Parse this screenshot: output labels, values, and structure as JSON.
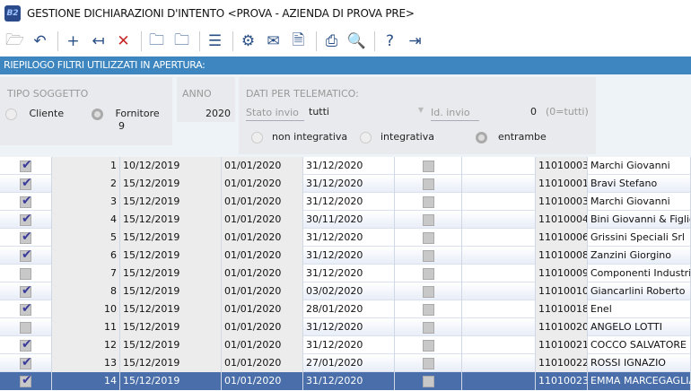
{
  "window": {
    "title": "GESTIONE DICHIARAZIONI D'INTENTO <PROVA - AZIENDA DI PROVA PRE>",
    "logo": "B2"
  },
  "toolbar": [
    [
      "open-folder-icon",
      "🗁",
      "#999"
    ],
    [
      "undo-icon",
      "↶",
      ""
    ],
    "|",
    [
      "add-icon",
      "+",
      ""
    ],
    [
      "revert-icon",
      "↤",
      ""
    ],
    [
      "delete-icon",
      "✕",
      "#c62828"
    ],
    "|",
    [
      "folder-green-icon",
      "🗀",
      ""
    ],
    [
      "folder-red-icon",
      "🗀",
      ""
    ],
    "|",
    [
      "menu-icon",
      "☰",
      ""
    ],
    "|",
    [
      "settings-icon",
      "⚙",
      ""
    ],
    [
      "mail-download-icon",
      "✉",
      ""
    ],
    [
      "pdf-icon",
      "🗎",
      ""
    ],
    "|",
    [
      "print-icon",
      "⎙",
      ""
    ],
    [
      "preview-icon",
      "🔍",
      ""
    ],
    "|",
    [
      "help-icon",
      "?",
      ""
    ],
    [
      "exit-icon",
      "⇥",
      ""
    ]
  ],
  "band": "RIEPILOGO FILTRI UTILIZZATI IN APERTURA:",
  "filters": {
    "tipo_label": "TIPO SOGGETTO",
    "cliente": "Cliente",
    "fornitore": "Fornitore",
    "fornitore_count": "9",
    "anno_label": "ANNO",
    "anno": "2020",
    "telematico_label": "DATI PER TELEMATICO:",
    "stato_label": "Stato invio",
    "stato_value": "tutti",
    "id_label": "Id. invio",
    "id_value": "0",
    "id_hint": "(0=tutti)",
    "non_integrativa": "non integrativa",
    "integrativa": "integrativa",
    "entrambe": "entrambe"
  },
  "rows": [
    [
      true,
      "1",
      "10/12/2019",
      "01/01/2020",
      "31/12/2020",
      "11010003",
      "Marchi Giovanni"
    ],
    [
      true,
      "2",
      "15/12/2019",
      "01/01/2020",
      "31/12/2020",
      "11010001",
      "Bravi Stefano"
    ],
    [
      true,
      "3",
      "15/12/2019",
      "01/01/2020",
      "31/12/2020",
      "11010003",
      "Marchi Giovanni"
    ],
    [
      true,
      "4",
      "15/12/2019",
      "01/01/2020",
      "30/11/2020",
      "11010004",
      "Bini Giovanni & Figlio"
    ],
    [
      true,
      "5",
      "15/12/2019",
      "01/01/2020",
      "31/12/2020",
      "11010006",
      "Grissini Speciali Srl"
    ],
    [
      true,
      "6",
      "15/12/2019",
      "01/01/2020",
      "31/12/2020",
      "11010008",
      "Zanzini Giorgino"
    ],
    [
      false,
      "7",
      "15/12/2019",
      "01/01/2020",
      "31/12/2020",
      "11010009",
      "Componenti Industri..."
    ],
    [
      true,
      "8",
      "15/12/2019",
      "01/01/2020",
      "03/02/2020",
      "11010010",
      "Giancarlini Roberto"
    ],
    [
      true,
      "10",
      "15/12/2019",
      "01/01/2020",
      "28/01/2020",
      "11010018",
      "Enel"
    ],
    [
      false,
      "11",
      "15/12/2019",
      "01/01/2020",
      "31/12/2020",
      "11010020",
      "ANGELO LOTTI"
    ],
    [
      true,
      "12",
      "15/12/2019",
      "01/01/2020",
      "31/12/2020",
      "11010021",
      "COCCO SALVATORE"
    ],
    [
      true,
      "13",
      "15/12/2019",
      "01/01/2020",
      "27/01/2020",
      "11010022",
      "ROSSI IGNAZIO"
    ],
    [
      true,
      "14",
      "15/12/2019",
      "01/01/2020",
      "31/12/2020",
      "11010023",
      "EMMA MARCEGAGLIA"
    ]
  ],
  "selected_row": 12
}
